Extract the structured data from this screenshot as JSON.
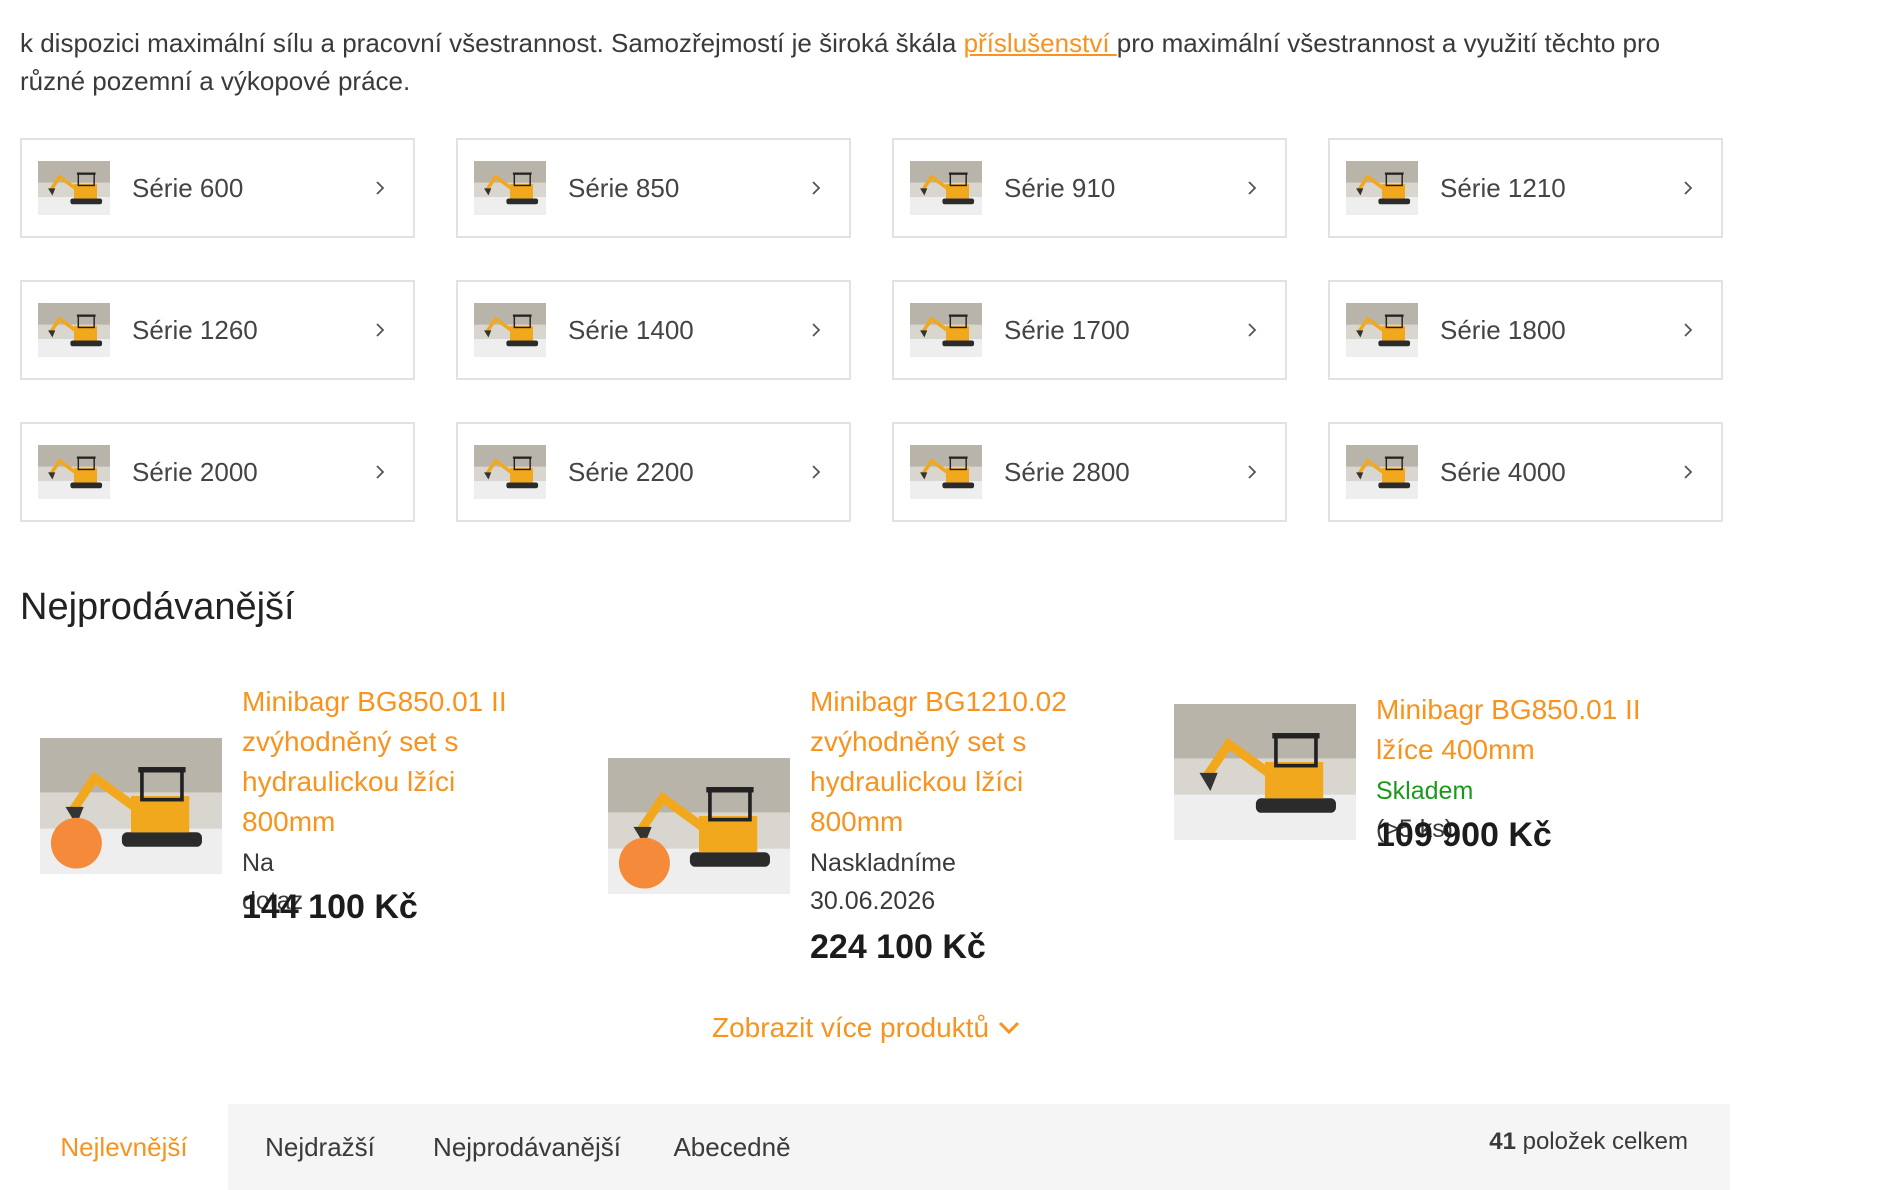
{
  "intro": {
    "text_before": "k dispozici maximální sílu a pracovní všestrannost. Samozřejmostí je široká škála ",
    "link": "příslušenství ",
    "text_after": "pro maximální všestrannost a využití těchto pro různé pozemní a výkopové práce."
  },
  "categories": [
    {
      "label": "Série 600",
      "icon": "chevron-right-icon"
    },
    {
      "label": "Série 850",
      "icon": "chevron-right-icon"
    },
    {
      "label": "Série 910",
      "icon": "chevron-right-icon"
    },
    {
      "label": "Série 1210",
      "icon": "chevron-right-icon"
    },
    {
      "label": "Série 1260",
      "icon": "chevron-right-icon"
    },
    {
      "label": "Série 1400",
      "icon": "chevron-right-icon"
    },
    {
      "label": "Série 1700",
      "icon": "chevron-right-icon"
    },
    {
      "label": "Série 1800",
      "icon": "chevron-right-icon"
    },
    {
      "label": "Série 2000",
      "icon": "chevron-right-icon"
    },
    {
      "label": "Série 2200",
      "icon": "chevron-right-icon"
    },
    {
      "label": "Série 2800",
      "icon": "chevron-right-icon"
    },
    {
      "label": "Série 4000",
      "icon": "chevron-right-icon"
    }
  ],
  "bestsellers": {
    "title": "Nejprodávanější",
    "products": [
      {
        "title": "Minibagr BG850.01 II zvýhodněný set s hydraulickou lžíci 800mm",
        "status": "Na dotaz",
        "price": "144 100 Kč"
      },
      {
        "title": "Minibagr BG1210.02 zvýhodněný set s hydraulickou lžíci 800mm",
        "status": "Naskladníme 30.06.2026",
        "price": "224 100 Kč"
      },
      {
        "title": "Minibagr BG850.01 II lžíce 400mm",
        "status_stock": "Skladem",
        "status_qty": "(>5 ks)",
        "price": "109 900 Kč"
      }
    ],
    "more_label": "Zobrazit více produktů"
  },
  "sort": {
    "tabs": [
      "Nejlevnější",
      "Nejdražší",
      "Nejprodávanější",
      "Abecedně"
    ],
    "active_tab": "Nejlevnější",
    "total_count": "41",
    "total_label": " položek celkem"
  },
  "colors": {
    "accent": "#f7931e",
    "in_stock": "#1a9a1a",
    "excavator": "#f2a81d"
  }
}
